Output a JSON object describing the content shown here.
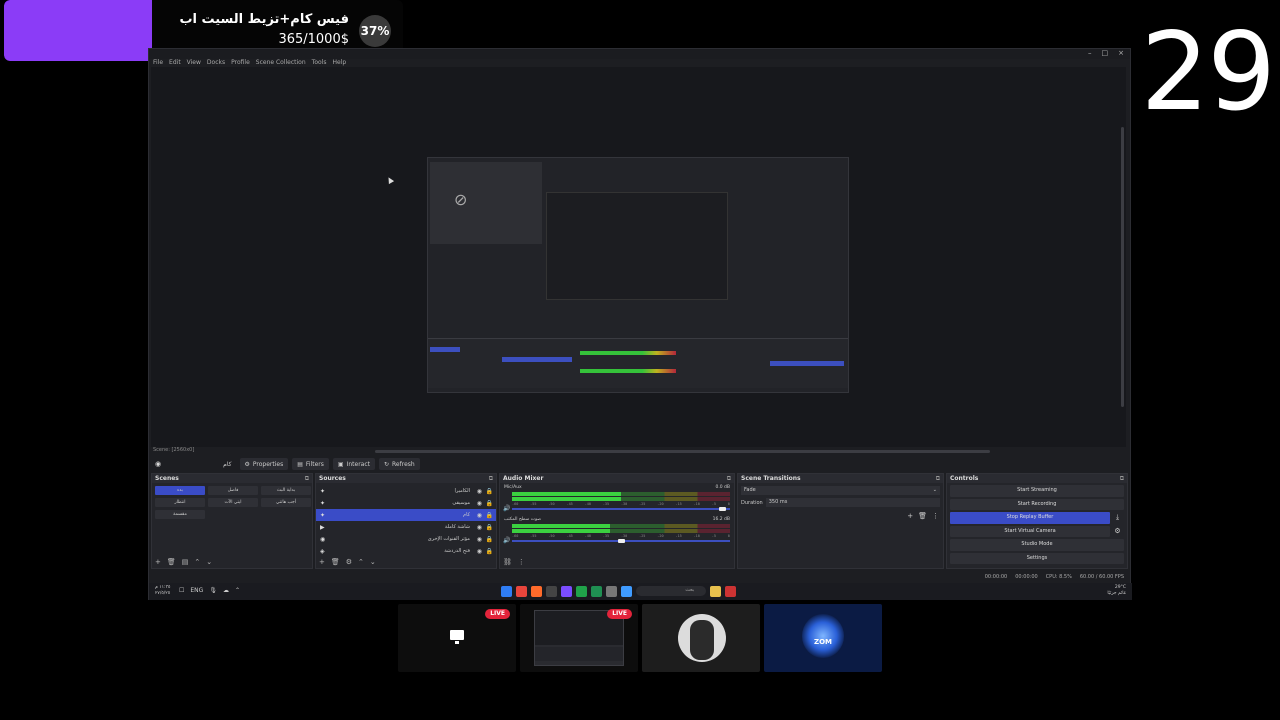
{
  "goal": {
    "title": "فيس كام+تزيط السيت اب",
    "amount": "365/1000$",
    "percent_label": "37%",
    "progress_fraction": 0.37,
    "fill_color": "#8b3cf7"
  },
  "counter": "29",
  "obs": {
    "window_controls": [
      "–",
      "□",
      "×"
    ],
    "menu": [
      "File",
      "Edit",
      "View",
      "Docks",
      "Profile",
      "Scene Collection",
      "Tools",
      "Help"
    ],
    "status_left": "Scene: [2560x0]",
    "context": {
      "label": "كام",
      "buttons": [
        "Properties",
        "Filters",
        "Interact",
        "Refresh"
      ]
    },
    "docks": {
      "scenes_title": "Scenes",
      "sources_title": "Sources",
      "mixer_title": "Audio Mixer",
      "transitions_title": "Scene Transitions",
      "controls_title": "Controls"
    },
    "scenes": [
      "بدء",
      "فاصل",
      "بداية البث",
      "انتظار",
      "ايتي الآت",
      "أجب هاتتي",
      "مقسمة"
    ],
    "sources": [
      {
        "name": "الكاميرا",
        "icon": "✦"
      },
      {
        "name": "موسيقى",
        "icon": "✦"
      },
      {
        "name": "كام",
        "icon": "✦"
      },
      {
        "name": "شاشة كاملة",
        "icon": "▶"
      },
      {
        "name": "مؤثر القنوات الإخرى",
        "icon": "◉"
      },
      {
        "name": "فتح الدردشة",
        "icon": "◈"
      }
    ],
    "mixer": [
      {
        "name": "Mic/Aux",
        "db": "0.0 dB",
        "level": 0.5,
        "volume": 0.98
      },
      {
        "name": "صوت سطح المكتب",
        "db": "16.2 dB",
        "level": 0.45,
        "volume": 0.52
      }
    ],
    "mixer_ticks": [
      "-60",
      "-55",
      "-50",
      "-45",
      "-40",
      "-35",
      "-30",
      "-25",
      "-20",
      "-15",
      "-10",
      "-5",
      "0"
    ],
    "transition": {
      "type": "Fade",
      "duration_label": "Duration",
      "duration": "350 ms"
    },
    "controls": [
      {
        "label": "Start Streaming",
        "active": false
      },
      {
        "label": "Start Recording",
        "active": false
      },
      {
        "label": "Stop Replay Buffer",
        "active": true,
        "side_icon": "⤓"
      },
      {
        "label": "Start Virtual Camera",
        "active": false,
        "side_icon": "⚙"
      },
      {
        "label": "Studio Mode",
        "active": false
      },
      {
        "label": "Settings",
        "active": false
      }
    ],
    "statusbar": {
      "rec_time": "00:00:00",
      "stream_time": "00:00:00",
      "cpu": "CPU: 8.5%",
      "fps": "60.00 / 60.00 FPS"
    },
    "taskbar": {
      "time": "١١:٣٥ م",
      "date": "٢٧/٥/٢٥",
      "lang": "ENG",
      "search_placeholder": "بحث",
      "weather_temp": "29°C",
      "weather_text": "غائم جزئيًا",
      "app_colors": [
        "#2f7df4",
        "#e8453c",
        "#ff6b2b",
        "#444",
        "#7b4dff",
        "#20a34a",
        "#1f8f52",
        "#777",
        "#3f9bff",
        "#e7c04d",
        "#c33"
      ]
    }
  },
  "thumbnails": {
    "live_label": "LIVE",
    "brand_text": "ZOM"
  }
}
